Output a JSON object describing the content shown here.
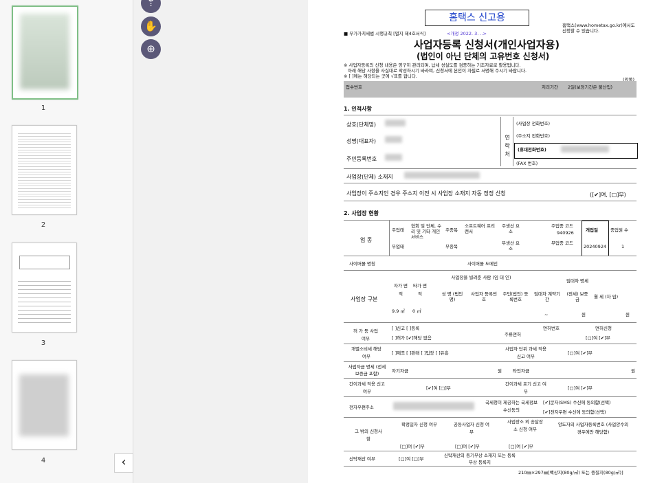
{
  "thumbs": [
    {
      "label": "1"
    },
    {
      "label": "2"
    },
    {
      "label": "3"
    },
    {
      "label": "4"
    }
  ],
  "tools": {
    "pointer": "⇡",
    "hand": "✋",
    "zoom": "⊕"
  },
  "collapse_glyph": "‹",
  "doc": {
    "stamp": "홈택스 신고용",
    "hometax_note1": "홈택스(www.hometax.go.kr)에서도",
    "hometax_note2": "신청할 수 있습니다.",
    "regulation": "■ 부가가치세법 시행규칙 [별지 제4호서식]",
    "revision": "<개정 2022. 3. ..>",
    "title": "사업자등록 신청서(개인사업자용)",
    "subtitle": "(법인이 아닌 단체의 고유번호 신청서)",
    "note1": "※ 사업자등록의 신청 내용은 영구히 관리되며, 납세 성실도를 검증하는 기초자료로 활용됩니다.",
    "note2": "아래 해당 사항을 사실대로 작성하시기 바라며, 신청서에 본인이 자필로 서명해 주시기 바랍니다.",
    "note3": "※ [  ]에는 해당되는 곳에 √표를 합니다.",
    "front": "(앞쪽)",
    "receipt": "접수번호",
    "processing": "처리기간",
    "processing_val": "2일(보정기간은 불산입)",
    "sec1": "1. 인적사항",
    "trade_name": "상호(단체명)",
    "rep_name": "성명(대표자)",
    "rrn": "주민등록번호",
    "contact": "연락처",
    "biz_phone": "(사업장 전화번호)",
    "home_phone": "(주소지 전화번호)",
    "mobile": "(휴대전화번호)",
    "fax": "(FAX 번호)",
    "biz_addr": "사업장(단체) 소재지",
    "addr_change": "사업장이 주소지인 경우 주소지 이전 시 사업장 소재지 자동 정정 신청",
    "addr_change_opt": "([✔]여, [□]부)",
    "sec2": "2. 사업장 현황",
    "industry": "업 종",
    "main_type": "주업태",
    "main_type_val": "협회 및 단체, 수리 및 기타 개인서비스",
    "main_item": "주종목",
    "main_item_val": "소프트웨어 프리랜서",
    "prod_elem": "주생산 요소",
    "main_code": "주업종 코드",
    "main_code_val": "940926",
    "open_date": "개업일",
    "open_date_val": "20240924",
    "employees": "종업원 수",
    "employees_val": "1",
    "sub_type": "부업태",
    "sub_item": "부종목",
    "sub_prod": "부생산 요소",
    "sub_code": "부업종 코드",
    "cyber_name": "사이버몰 명칭",
    "cyber_domain": "사이버몰 도메인",
    "site_type": "사업장 구분",
    "own": "자가 면적",
    "other": "타가 면적",
    "lessor": "사업장을 빌려준 사람 (임 대 인)",
    "lessor_name": "성 명 (법인명)",
    "lessor_biz": "사업자 등록번호",
    "lessor_rrn": "주민(법인) 등록번호",
    "lease": "임대차 명세",
    "lease_period": "임대차 계약기간",
    "deposit": "(전세) 보증금",
    "monthly": "월 세 (차 임)",
    "own_val": "9.9 ㎡",
    "other_val": "0 ㎡",
    "tilde": "~",
    "won": "원",
    "permit": "허 가 등 사업 여부",
    "permit_opt1": "[ ]신고    [ ]등록",
    "permit_opt2": "[ ]허가  [✔]해당 없음",
    "liquor": "주류면허",
    "liquor_no": "면허번호",
    "liquor_req": "면허신청",
    "liquor_opt": "[□]여   [✔]부",
    "excise": "개별소비세 해당 여부",
    "excise_opt": "[ ]제조 [ ]판매 [ ]입장 [ ]유흥",
    "unit_tax": "사업자 단위 과세 적용 신고 여부",
    "unit_tax_opt": "[□]여     [✔]부",
    "fund": "사업자금 명세 (전세보증금 포함)",
    "own_fund": "자기자금",
    "other_fund": "타인자금",
    "simple_tax": "간이과세 적용 신고 여부",
    "simple_opt": "[✔]여     [□]부",
    "simple_quit": "간이과세 포기 신고 여부",
    "simple_quit_opt": "[□]여     [✔]부",
    "email": "전자우편주소",
    "nts_info": "국세청이 제공하는 국세정보 수신동의",
    "sms": "[✔]문자(SMS) 수신에 동의함(선택)",
    "mail": "[✔]전자우편 수신에 동의함(선택)",
    "etc": "그 밖의 신청사항",
    "confirm": "확정일자 신청 여부",
    "joint": "공동사업자 신청 여부",
    "delivery": "사업장소 외 송달장소 신청 여부",
    "transfer": "양도자의 사업자등록번호 (사업양수의 경우에만 해당함)",
    "etc_opt1": "[□]여  [✔]부",
    "etc_opt2": "[□]여  [✔]부",
    "etc_opt3": "[□]여  [✔]부",
    "trust": "신탁재산 여부",
    "trust_opt": "[□]여  [□]부",
    "trust_reg": "신탁재산의 등기부상 소재지 또는 등록부상 등록지",
    "paper": "210㎜×297㎜[백상지(80g/㎡) 또는 중질지(80g/㎡)]"
  }
}
